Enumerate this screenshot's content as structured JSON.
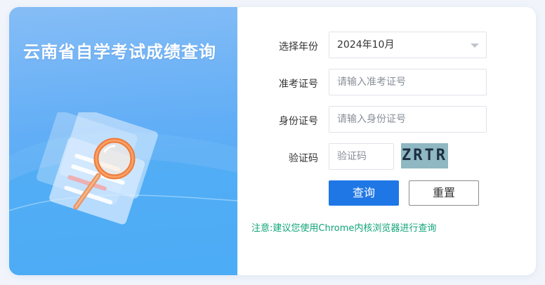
{
  "header": {
    "title": "云南省自学考试成绩查询"
  },
  "form": {
    "year": {
      "label": "选择年份",
      "value": "2024年10月"
    },
    "exam_no": {
      "label": "准考证号",
      "placeholder": "请输入准考证号"
    },
    "id_no": {
      "label": "身份证号",
      "placeholder": "请输入身份证号"
    },
    "captcha": {
      "label": "验证码",
      "placeholder": "验证码",
      "image_text": "ZRTR"
    }
  },
  "buttons": {
    "query": "查询",
    "reset": "重置"
  },
  "notice": "注意:建议您使用Chrome内核浏览器进行查询",
  "colors": {
    "primary": "#1f77e6",
    "notice": "#11a47a",
    "panel_gradient_top": "#86bdf6",
    "panel_gradient_bottom": "#3fa6f5"
  }
}
